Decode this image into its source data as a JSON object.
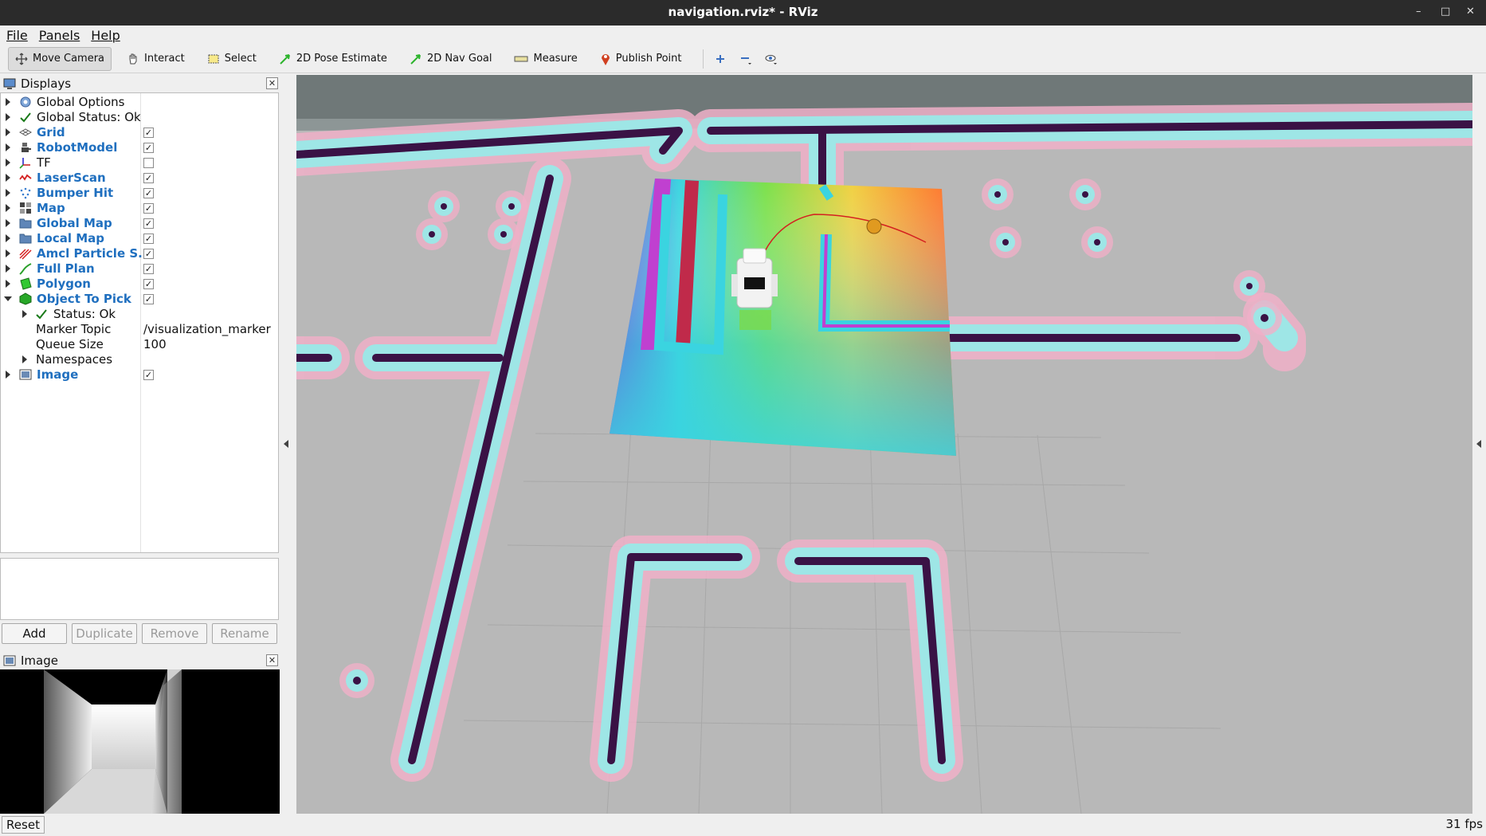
{
  "window": {
    "title": "navigation.rviz* - RViz"
  },
  "menu": [
    "File",
    "Panels",
    "Help"
  ],
  "toolbar": {
    "tools": [
      {
        "label": "Move Camera",
        "icon": "move-camera-icon",
        "active": true
      },
      {
        "label": "Interact",
        "icon": "hand-icon"
      },
      {
        "label": "Select",
        "icon": "select-icon"
      },
      {
        "label": "2D Pose Estimate",
        "icon": "pose-arrow-icon"
      },
      {
        "label": "2D Nav Goal",
        "icon": "goal-arrow-icon"
      },
      {
        "label": "Measure",
        "icon": "ruler-icon"
      },
      {
        "label": "Publish Point",
        "icon": "pin-icon"
      }
    ]
  },
  "displays_panel": {
    "title": "Displays",
    "items": [
      {
        "label": "Global Options",
        "icon": "gear-icon"
      },
      {
        "label": "Global Status: Ok",
        "icon": "check-icon"
      },
      {
        "label": "Grid",
        "icon": "grid-icon",
        "checked": true
      },
      {
        "label": "RobotModel",
        "icon": "robot-icon",
        "checked": true
      },
      {
        "label": "TF",
        "icon": "tf-axes-icon",
        "checked": false
      },
      {
        "label": "LaserScan",
        "icon": "laserscan-icon",
        "checked": true
      },
      {
        "label": "Bumper Hit",
        "icon": "pointcloud-icon",
        "checked": true
      },
      {
        "label": "Map",
        "icon": "map-icon",
        "checked": true
      },
      {
        "label": "Global Map",
        "icon": "folder-icon",
        "checked": true
      },
      {
        "label": "Local Map",
        "icon": "folder-icon",
        "checked": true
      },
      {
        "label": "Amcl Particle S...",
        "icon": "pose-array-icon",
        "checked": true
      },
      {
        "label": "Full Plan",
        "icon": "path-icon",
        "checked": true
      },
      {
        "label": "Polygon",
        "icon": "polygon-icon",
        "checked": true
      },
      {
        "label": "Object  To Pick",
        "icon": "marker-cube-icon",
        "checked": true
      },
      {
        "label": "Status: Ok",
        "icon": "check-icon"
      },
      {
        "label": "Marker Topic",
        "value": "/visualization_marker"
      },
      {
        "label": "Queue Size",
        "value": "100"
      },
      {
        "label": "Namespaces"
      },
      {
        "label": "Image",
        "icon": "image-icon",
        "checked": true
      }
    ],
    "buttons": {
      "add": "Add",
      "duplicate": "Duplicate",
      "remove": "Remove",
      "rename": "Rename"
    }
  },
  "image_panel": {
    "title": "Image"
  },
  "status": {
    "reset": "Reset",
    "fps": "31 fps"
  }
}
